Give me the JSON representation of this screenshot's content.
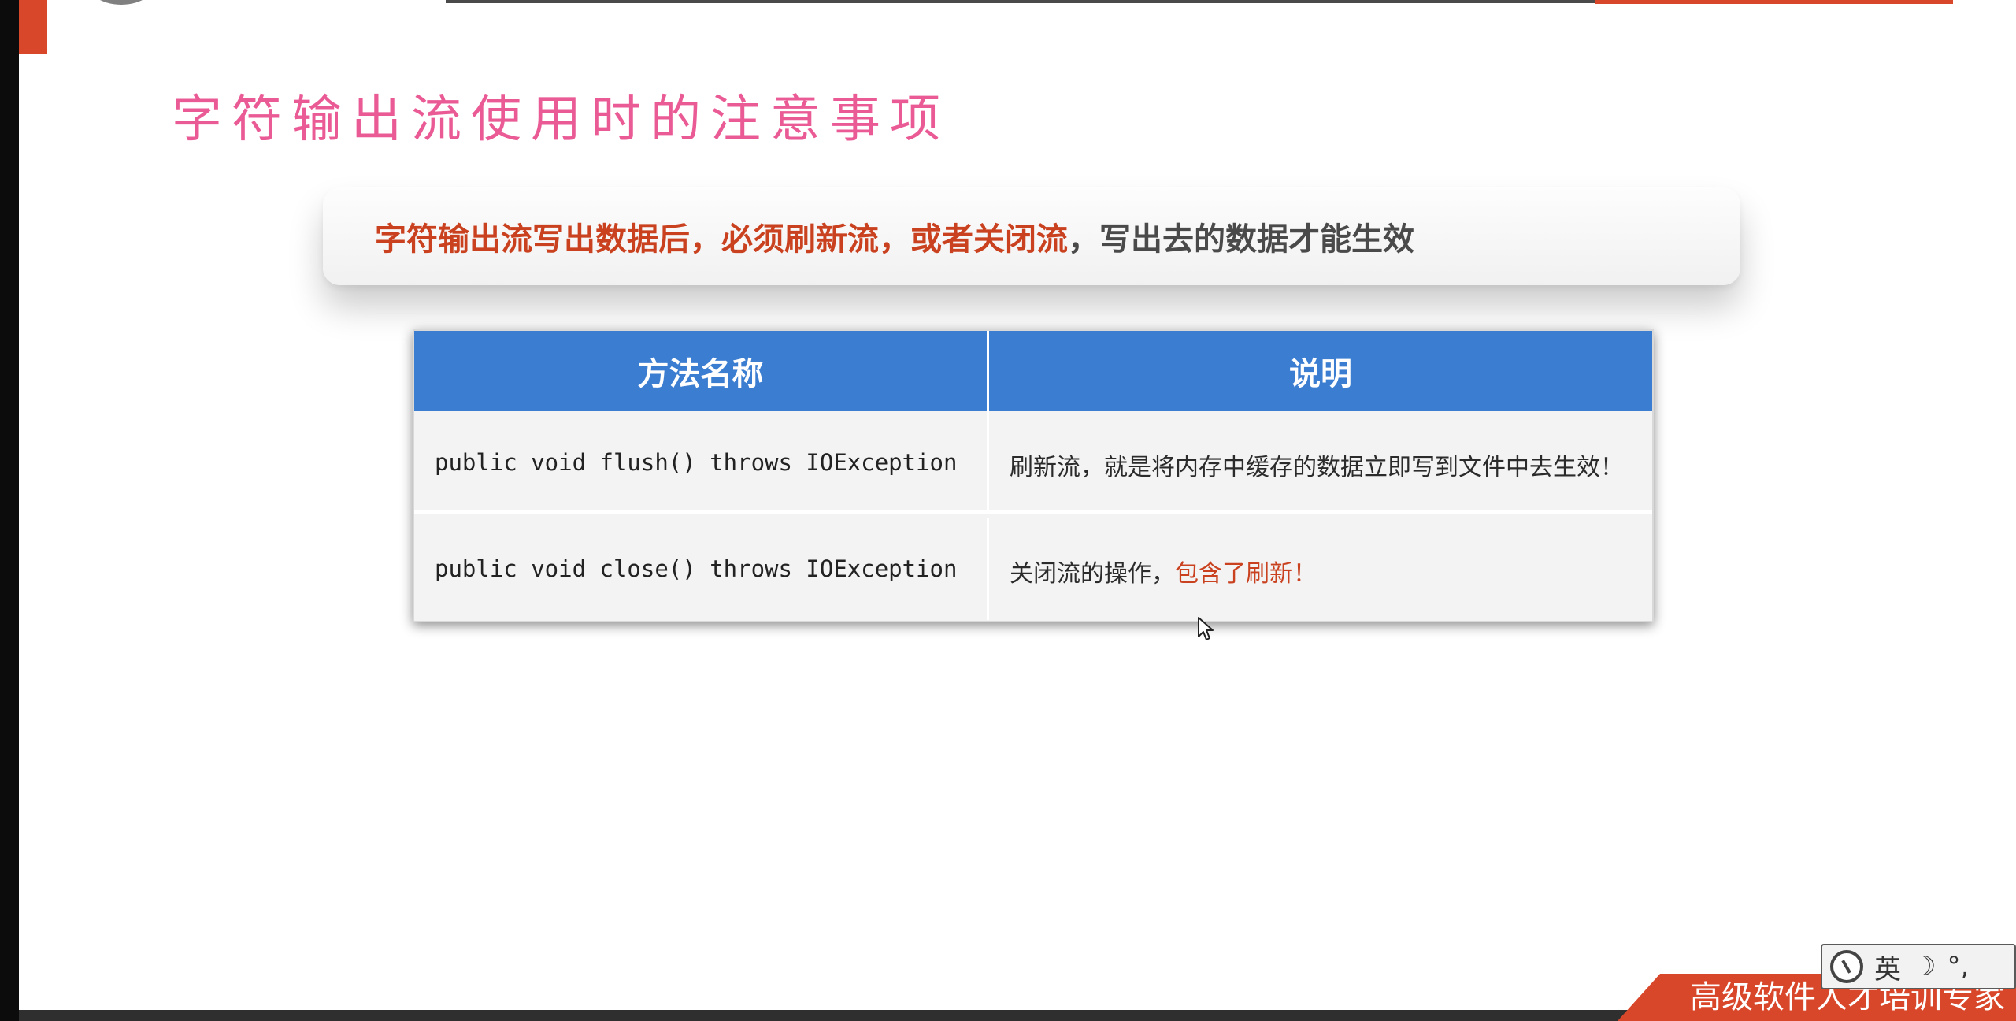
{
  "slide": {
    "title": "字符输出流使用时的注意事项",
    "notice": {
      "part1": "字符输出流写出数据后，必须刷新流，或者关闭流",
      "part2": "，写出去的数据才能生效"
    }
  },
  "table": {
    "headers": [
      "方法名称",
      "说明"
    ],
    "rows": [
      {
        "method": "public void flush() throws IOException",
        "desc": "刷新流，就是将内存中缓存的数据立即写到文件中去生效！",
        "desc_red": ""
      },
      {
        "method": "public void close() throws IOException",
        "desc": "关闭流的操作，",
        "desc_red": "包含了刷新！"
      }
    ]
  },
  "ime": {
    "mode": "英",
    "moon": "☽",
    "punct": "°,"
  },
  "footer": {
    "brand": "高级软件人才培训专家"
  },
  "colors": {
    "accent": "#d9472b",
    "title": "#ea5b96",
    "header_blue": "#3b7dd0",
    "notice_red": "#c9411f"
  }
}
